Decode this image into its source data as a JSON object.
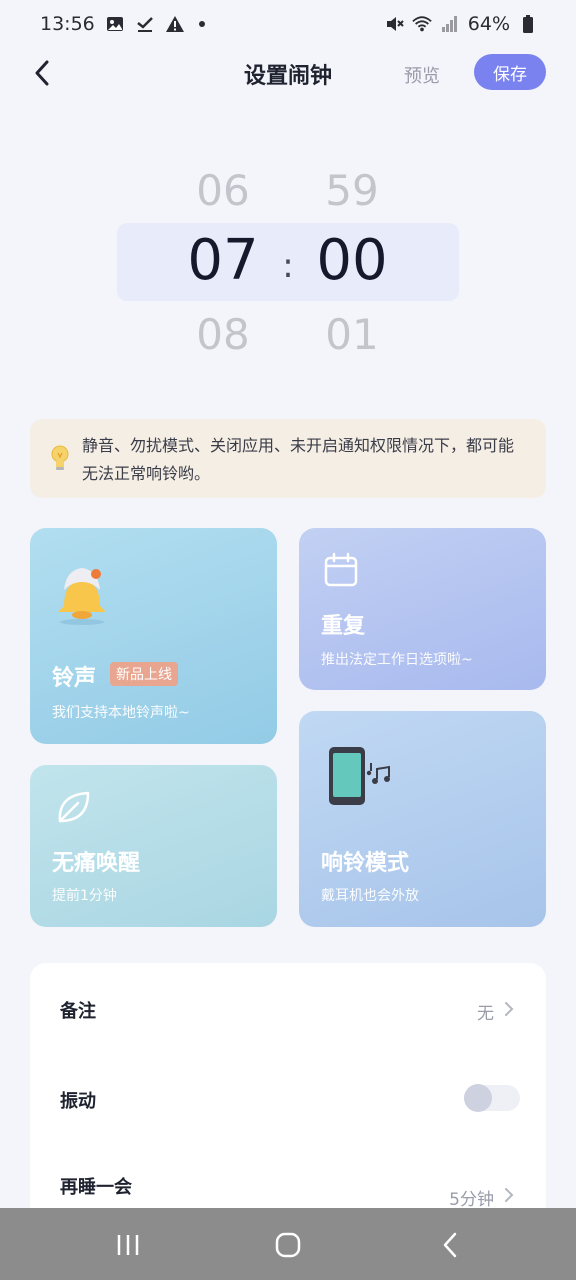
{
  "status_bar": {
    "time": "13:56",
    "battery": "64%",
    "icons": [
      "image-icon",
      "check-icon",
      "warning-icon",
      "dot-icon",
      "mute-icon",
      "wifi-icon",
      "signal-icon",
      "battery-icon"
    ]
  },
  "header": {
    "title": "设置闹钟",
    "preview_label": "预览",
    "save_label": "保存",
    "accent_color": "#7a82ef"
  },
  "picker": {
    "hour_prev": "06",
    "hour": "07",
    "hour_next": "08",
    "separator": ":",
    "minute_prev": "59",
    "minute": "00",
    "minute_next": "01"
  },
  "tip": {
    "text": "静音、勿扰模式、关闭应用、未开启通知权限情况下，都可能无法正常响铃哟。"
  },
  "cards": {
    "ringtone": {
      "title": "铃声",
      "badge": "新品上线",
      "subtitle": "我们支持本地铃声啦~",
      "icon": "bell-icon"
    },
    "repeat": {
      "title": "重复",
      "subtitle": "推出法定工作日选项啦~",
      "icon": "calendar-icon"
    },
    "gentle_wake": {
      "title": "无痛唤醒",
      "subtitle": "提前1分钟",
      "icon": "leaf-icon"
    },
    "ring_mode": {
      "title": "响铃模式",
      "subtitle": "戴耳机也会外放",
      "icon": "phone-music-icon"
    }
  },
  "settings": {
    "note": {
      "label": "备注",
      "value": "无"
    },
    "vibrate": {
      "label": "振动",
      "on": false
    },
    "snooze": {
      "label": "再睡一会",
      "value": "5分钟"
    }
  },
  "navbar": {
    "buttons": [
      "recent-apps-icon",
      "home-icon",
      "back-icon"
    ]
  }
}
